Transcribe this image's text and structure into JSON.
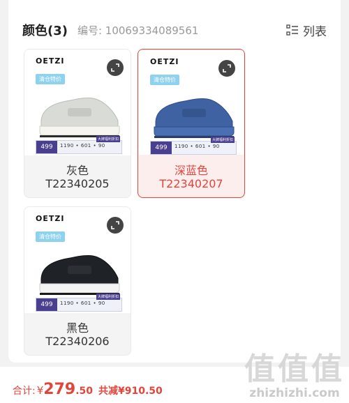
{
  "header": {
    "title": "颜色(3)",
    "sku": "编号: 10069334089561",
    "list_label": "列表"
  },
  "cards": [
    {
      "name": "灰色",
      "code": "T22340205",
      "brand": "OETZI",
      "tag": "清仓特价",
      "price": "499",
      "strip_nums": "1190 • 601 • 90",
      "strip_chip": "大牌福利折扣",
      "selected": false,
      "shoe_color": "#d9dcd6"
    },
    {
      "name": "深蓝色",
      "code": "T22340207",
      "brand": "OETZI",
      "tag": "清仓特价",
      "price": "499",
      "strip_nums": "1190 • 601 • 90",
      "strip_chip": "大牌福利折扣",
      "selected": true,
      "shoe_color": "#3f62a3"
    },
    {
      "name": "黑色",
      "code": "T22340206",
      "brand": "OETZI",
      "tag": "清仓特价",
      "price": "499",
      "strip_nums": "1190 • 601 • 90",
      "strip_chip": "大牌福利折扣",
      "selected": false,
      "shoe_color": "#1f2226"
    }
  ],
  "footer": {
    "total_label": "合计:",
    "currency": "¥",
    "total_int": "279",
    "total_dec": ".50",
    "saving": "共减¥910.50"
  },
  "watermark": {
    "logo": "值值值",
    "url": "zhizhizhi.com"
  },
  "colors": {
    "accent": "#e2453c",
    "price_purple": "#4a3e8e",
    "tag_blue": "#8ed2ef"
  }
}
